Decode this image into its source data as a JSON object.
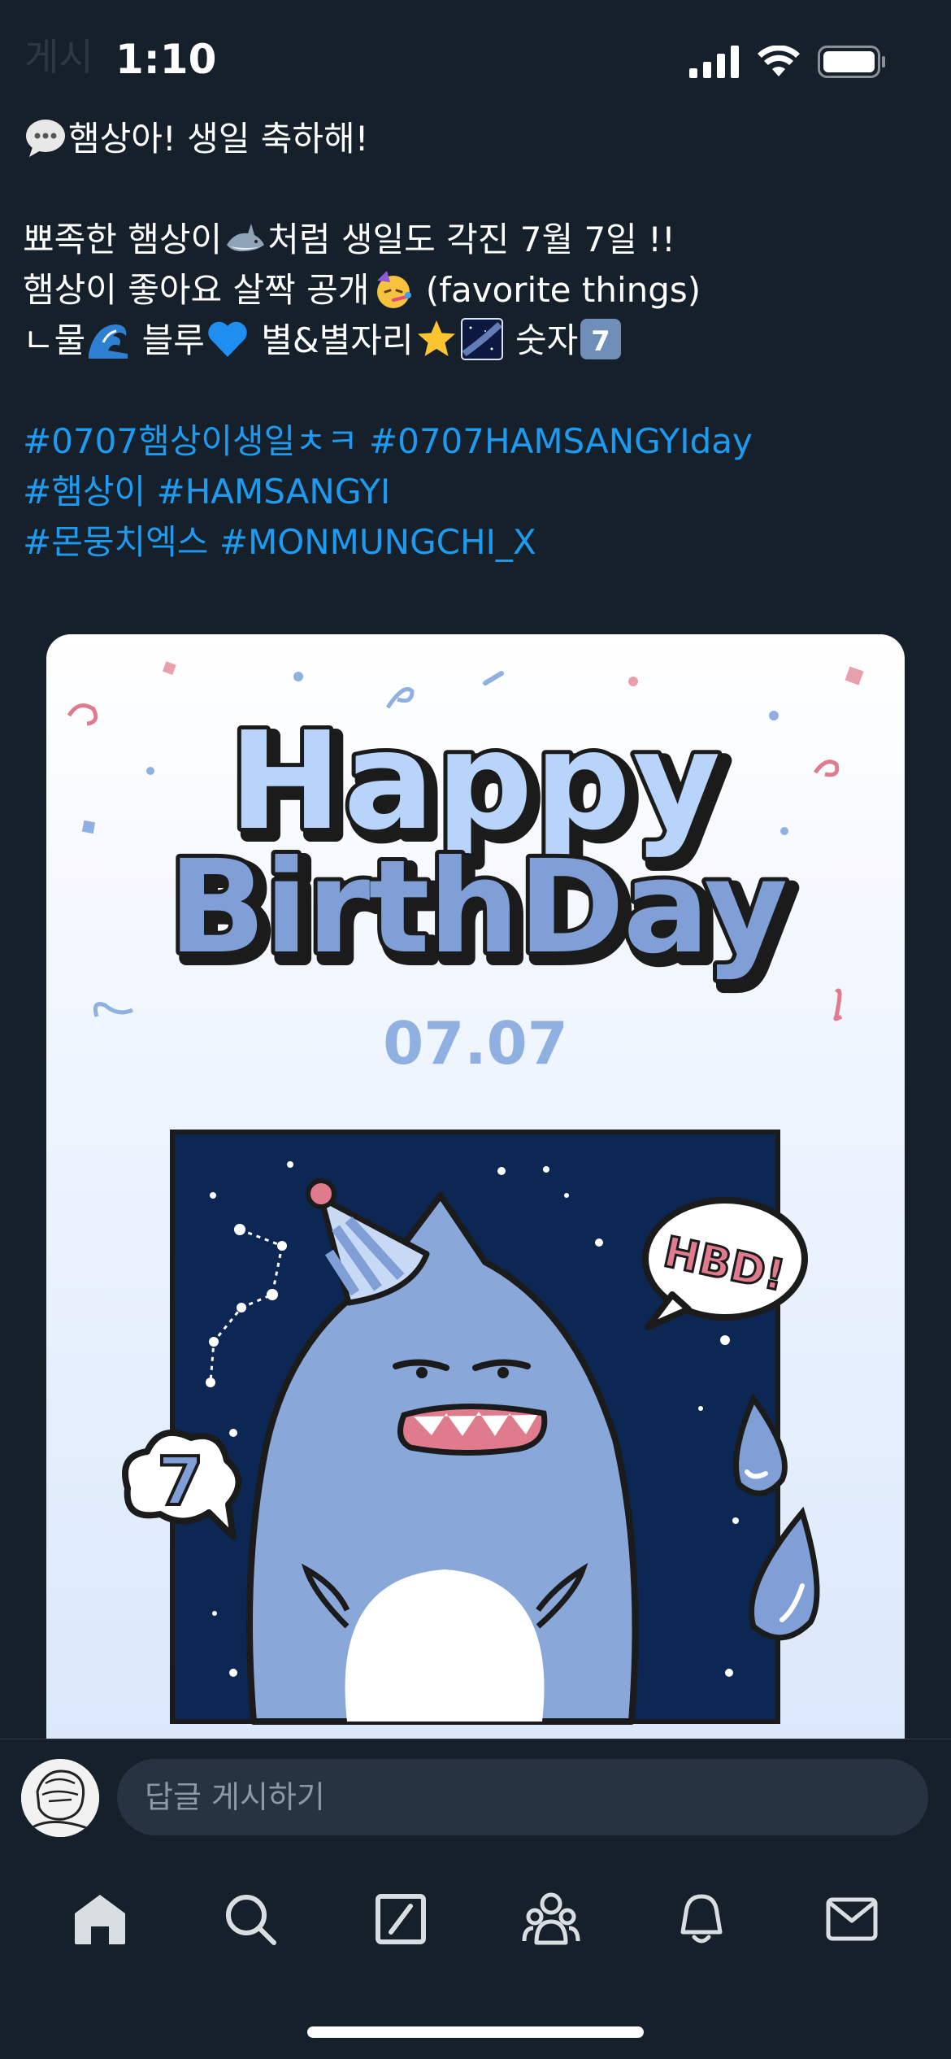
{
  "status_bar": {
    "time": "1:10",
    "signal_icon": "cellular-signal-icon",
    "wifi_icon": "wifi-icon",
    "battery_icon": "battery-icon"
  },
  "header": {
    "ghost_text": "게시"
  },
  "tweet": {
    "line1_text": "햄상아! 생일 축하해!",
    "line2_a": "뾰족한 햄상이",
    "line2_b": "처럼 생일도 각진 7월 7일 !!",
    "line3_a": "햄상이 좋아요 살짝 공개",
    "line3_b": " (favorite things)",
    "line4_a": " ㄴ물",
    "line4_b": " 블루",
    "line4_c": " 별&별자리",
    "line4_d": " 숫자",
    "hashtags": [
      [
        "#0707햄상이생일ㅊㅋ",
        "#0707HAMSANGYIday"
      ],
      [
        "#햄상이",
        "#HAMSANGYI"
      ],
      [
        "#몬뭉치엑스",
        "#MONMUNGCHI_X"
      ]
    ],
    "emojis": [
      "speech-bubble-emoji",
      "shark-emoji",
      "party-face-emoji",
      "wave-emoji",
      "blue-heart-emoji",
      "star-emoji",
      "milky-way-emoji",
      "keycap-7-emoji"
    ]
  },
  "image": {
    "title_line1": "Happy",
    "title_line2": "BirthDay",
    "date": "07.07",
    "speech_bubble": "HBD!",
    "number_bubble": "7",
    "colors": {
      "title_fill": "#b8d4fa",
      "title_line2_fill": "#7f9fd6",
      "outline": "#1b1b1b",
      "night_sky": "#0d2755",
      "shark": "#8aa7da",
      "accent_pink": "#e07b8d",
      "date": "#8fb0e0"
    }
  },
  "reply": {
    "placeholder": "답글 게시하기"
  },
  "nav": {
    "items": [
      "home-icon",
      "search-icon",
      "grok-icon",
      "communities-icon",
      "notifications-icon",
      "messages-icon"
    ]
  }
}
